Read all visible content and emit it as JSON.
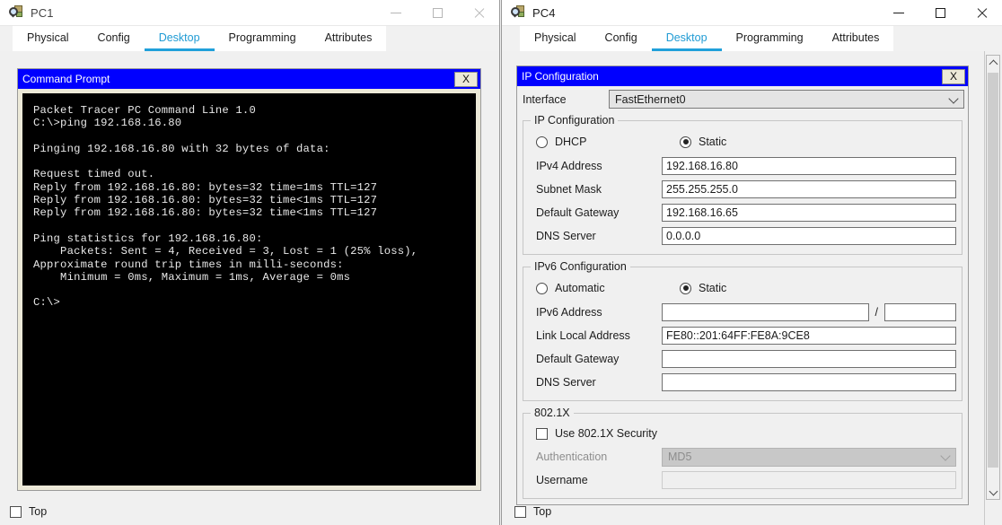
{
  "windows": {
    "left": {
      "title": "PC1",
      "icon": "packet-tracer-pc-icon",
      "controls": {
        "minimize": "–",
        "maximize": "□",
        "close": "✕"
      },
      "tabs": [
        {
          "label": "Physical",
          "active": false
        },
        {
          "label": "Config",
          "active": false
        },
        {
          "label": "Desktop",
          "active": true
        },
        {
          "label": "Programming",
          "active": false
        },
        {
          "label": "Attributes",
          "active": false
        }
      ],
      "command_prompt": {
        "title": "Command Prompt",
        "close_label": "X",
        "output": "Packet Tracer PC Command Line 1.0\nC:\\>ping 192.168.16.80\n\nPinging 192.168.16.80 with 32 bytes of data:\n\nRequest timed out.\nReply from 192.168.16.80: bytes=32 time=1ms TTL=127\nReply from 192.168.16.80: bytes=32 time<1ms TTL=127\nReply from 192.168.16.80: bytes=32 time<1ms TTL=127\n\nPing statistics for 192.168.16.80:\n    Packets: Sent = 4, Received = 3, Lost = 1 (25% loss),\nApproximate round trip times in milli-seconds:\n    Minimum = 0ms, Maximum = 1ms, Average = 0ms\n\nC:\\>"
      },
      "footer": {
        "top_label": "Top",
        "top_checked": false
      }
    },
    "right": {
      "title": "PC4",
      "icon": "packet-tracer-pc-icon",
      "controls": {
        "minimize": "–",
        "maximize": "□",
        "close": "✕"
      },
      "tabs": [
        {
          "label": "Physical",
          "active": false
        },
        {
          "label": "Config",
          "active": false
        },
        {
          "label": "Desktop",
          "active": true
        },
        {
          "label": "Programming",
          "active": false
        },
        {
          "label": "Attributes",
          "active": false
        }
      ],
      "ip_configuration": {
        "title": "IP Configuration",
        "close_label": "X",
        "interface": {
          "label": "Interface",
          "value": "FastEthernet0"
        },
        "ipv4": {
          "legend": "IP Configuration",
          "mode_dhcp": "DHCP",
          "mode_static": "Static",
          "selected_mode": "Static",
          "fields": [
            {
              "label": "IPv4 Address",
              "value": "192.168.16.80"
            },
            {
              "label": "Subnet Mask",
              "value": "255.255.255.0"
            },
            {
              "label": "Default Gateway",
              "value": "192.168.16.65"
            },
            {
              "label": "DNS Server",
              "value": "0.0.0.0"
            }
          ]
        },
        "ipv6": {
          "legend": "IPv6 Configuration",
          "mode_automatic": "Automatic",
          "mode_static": "Static",
          "selected_mode": "Static",
          "address_label": "IPv6 Address",
          "address_value": "",
          "prefix_separator": "/",
          "prefix_value": "",
          "fields": [
            {
              "label": "Link Local Address",
              "value": "FE80::201:64FF:FE8A:9CE8"
            },
            {
              "label": "Default Gateway",
              "value": ""
            },
            {
              "label": "DNS Server",
              "value": ""
            }
          ]
        },
        "dot1x": {
          "legend": "802.1X",
          "use_security_label": "Use 802.1X Security",
          "use_security_checked": false,
          "authentication_label": "Authentication",
          "authentication_value": "MD5",
          "username_label": "Username",
          "username_value": ""
        }
      },
      "footer": {
        "top_label": "Top",
        "top_checked": false
      },
      "scrollbar": {
        "up": "▲",
        "down": "▼"
      }
    }
  },
  "colors": {
    "dialog_titlebar": "#0000ff",
    "active_tab": "#21a0da",
    "terminal_bg": "#000000",
    "terminal_fg": "#e8e8e8",
    "cmd_panel_bg": "#ece9d8"
  }
}
